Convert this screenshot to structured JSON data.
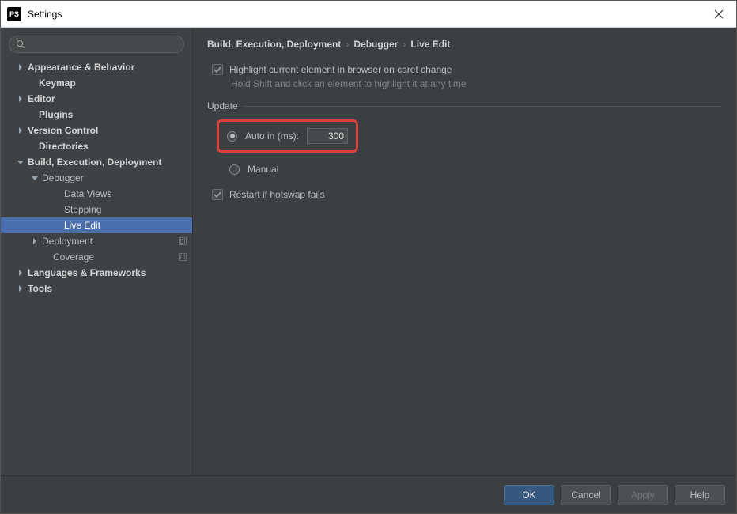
{
  "window": {
    "app_icon_text": "PS",
    "title": "Settings"
  },
  "sidebar": {
    "search_placeholder": "",
    "items": [
      {
        "label": "Appearance & Behavior",
        "indent": 20,
        "arrow": "right",
        "bold": true
      },
      {
        "label": "Keymap",
        "indent": 34,
        "arrow": "",
        "bold": true
      },
      {
        "label": "Editor",
        "indent": 20,
        "arrow": "right",
        "bold": true
      },
      {
        "label": "Plugins",
        "indent": 34,
        "arrow": "",
        "bold": true
      },
      {
        "label": "Version Control",
        "indent": 20,
        "arrow": "right",
        "bold": true
      },
      {
        "label": "Directories",
        "indent": 34,
        "arrow": "",
        "bold": true
      },
      {
        "label": "Build, Execution, Deployment",
        "indent": 20,
        "arrow": "down",
        "bold": true
      },
      {
        "label": "Debugger",
        "indent": 38,
        "arrow": "down",
        "bold": false
      },
      {
        "label": "Data Views",
        "indent": 66,
        "arrow": "",
        "bold": false
      },
      {
        "label": "Stepping",
        "indent": 66,
        "arrow": "",
        "bold": false
      },
      {
        "label": "Live Edit",
        "indent": 66,
        "arrow": "",
        "bold": false,
        "selected": true
      },
      {
        "label": "Deployment",
        "indent": 38,
        "arrow": "right",
        "bold": false,
        "tail_icon": true
      },
      {
        "label": "Coverage",
        "indent": 52,
        "arrow": "",
        "bold": false,
        "tail_icon": true
      },
      {
        "label": "Languages & Frameworks",
        "indent": 20,
        "arrow": "right",
        "bold": true
      },
      {
        "label": "Tools",
        "indent": 20,
        "arrow": "right",
        "bold": true
      }
    ]
  },
  "breadcrumb": {
    "part1": "Build, Execution, Deployment",
    "part2": "Debugger",
    "part3": "Live Edit"
  },
  "content": {
    "highlight_checkbox_label": "Highlight current element in browser on caret change",
    "highlight_hint": "Hold Shift and click an element to highlight it at any time",
    "update_group_label": "Update",
    "auto_label": "Auto in (ms):",
    "auto_value": "300",
    "manual_label": "Manual",
    "restart_label": "Restart if hotswap fails"
  },
  "footer": {
    "ok": "OK",
    "cancel": "Cancel",
    "apply": "Apply",
    "help": "Help"
  }
}
